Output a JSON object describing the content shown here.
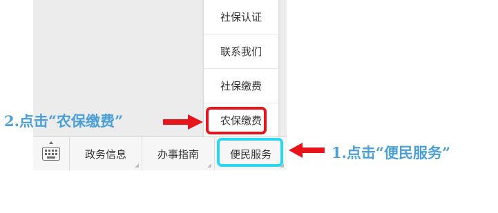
{
  "popup_menu": {
    "items": [
      "社保认证",
      "联系我们",
      "社保缴费",
      "农保缴费"
    ]
  },
  "bottom_bar": {
    "keyboard_icon": "keyboard-icon",
    "tabs": [
      "政务信息",
      "办事指南",
      "便民服务"
    ]
  },
  "annotations": {
    "step2": "2.点击“农保缴费”",
    "step1": "1.点击“便民服务”"
  },
  "colors": {
    "annotation_text": "#4a9fd6",
    "arrow_red": "#e8141c",
    "highlight_menu": "#e8141c",
    "highlight_tab": "#29d8f0"
  }
}
